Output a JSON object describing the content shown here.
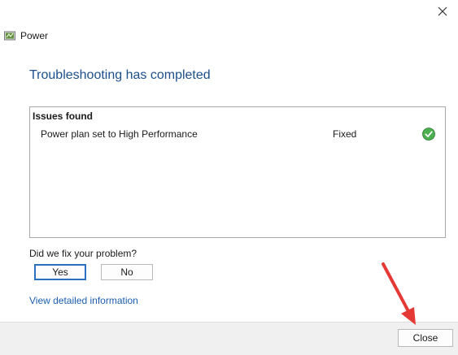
{
  "window": {
    "title": "Power",
    "close_icon": "close-icon",
    "app_icon": "power-troubleshooter-icon"
  },
  "main": {
    "heading": "Troubleshooting has completed",
    "issues": {
      "header": "Issues found",
      "items": [
        {
          "name": "Power plan set to High Performance",
          "status": "Fixed",
          "status_icon": "check-circle-icon"
        }
      ]
    },
    "feedback": {
      "question": "Did we fix your problem?",
      "yes_label": "Yes",
      "no_label": "No"
    },
    "details_link": "View detailed information"
  },
  "footer": {
    "close_label": "Close"
  },
  "annotation": {
    "icon": "red-arrow-icon",
    "color": "#e53935"
  },
  "colors": {
    "heading": "#1c4f8c",
    "link": "#1c5fb0",
    "focus_border": "#2b6fc1",
    "success": "#4caf50"
  }
}
